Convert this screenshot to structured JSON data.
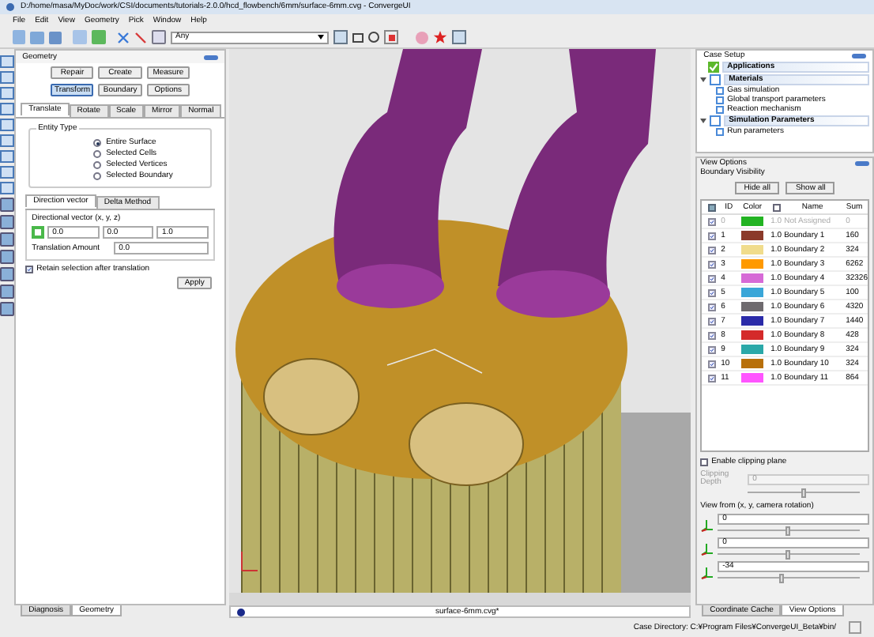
{
  "window": {
    "title": "D:/home/masa/MyDoc/work/CSI/documents/tutorials-2.0.0/hcd_flowbench/6mm/surface-6mm.cvg - ConvergeUI"
  },
  "menu": [
    "File",
    "Edit",
    "View",
    "Geometry",
    "Pick",
    "Window",
    "Help"
  ],
  "toolbar": {
    "filter_dropdown": "Any"
  },
  "geometry_panel": {
    "title": "Geometry",
    "buttons": [
      {
        "label": "Repair",
        "selected": false
      },
      {
        "label": "Create",
        "selected": false
      },
      {
        "label": "Measure",
        "selected": false
      },
      {
        "label": "Transform",
        "selected": true
      },
      {
        "label": "Boundary",
        "selected": false
      },
      {
        "label": "Options",
        "selected": false
      }
    ],
    "tabs": [
      {
        "label": "Translate",
        "selected": true
      },
      {
        "label": "Rotate",
        "selected": false
      },
      {
        "label": "Scale",
        "selected": false
      },
      {
        "label": "Mirror",
        "selected": false
      },
      {
        "label": "Normal",
        "selected": false
      }
    ],
    "entity_type": {
      "title": "Entity Type",
      "options": [
        {
          "label": "Entire Surface",
          "selected": true
        },
        {
          "label": "Selected Cells",
          "selected": false
        },
        {
          "label": "Selected Vertices",
          "selected": false
        },
        {
          "label": "Selected Boundary",
          "selected": false
        }
      ]
    },
    "method_tabs": [
      {
        "label": "Direction vector",
        "selected": true
      },
      {
        "label": "Delta Method",
        "selected": false
      }
    ],
    "vector_label": "Directional vector (x, y, z)",
    "vector": [
      "0.0",
      "0.0",
      "1.0"
    ],
    "amount_label": "Translation Amount",
    "amount": "0.0",
    "retain": {
      "label": "Retain selection after translation",
      "checked": true
    },
    "apply": "Apply"
  },
  "left_bottom_tabs": [
    {
      "label": "Diagnosis",
      "selected": false
    },
    {
      "label": "Geometry",
      "selected": true
    }
  ],
  "viewport_tab": "surface-6mm.cvg*",
  "case_setup": {
    "title": "Case Setup",
    "items": [
      {
        "label": "Applications",
        "checked": true
      },
      {
        "label": "Materials",
        "checked": false,
        "children": [
          {
            "label": "Gas simulation"
          },
          {
            "label": "Global transport parameters"
          },
          {
            "label": "Reaction mechanism"
          }
        ]
      },
      {
        "label": "Simulation Parameters",
        "checked": false,
        "children": [
          {
            "label": "Run parameters"
          }
        ]
      }
    ]
  },
  "view_options": {
    "title": "View Options",
    "subtitle": "Boundary Visibility",
    "buttons": [
      "Hide all",
      "Show all"
    ],
    "columns": [
      "ID",
      "Color",
      "Name",
      "Sum"
    ],
    "rows": [
      {
        "id": "0",
        "color": "#22b322",
        "opacity": "1.0",
        "name": "Not Assigned",
        "sum": "0",
        "checked": true,
        "disabled": true
      },
      {
        "id": "1",
        "color": "#8b3a2a",
        "opacity": "1.0",
        "name": "Boundary 1",
        "sum": "160",
        "checked": true,
        "disabled": false
      },
      {
        "id": "2",
        "color": "#f0dc8c",
        "opacity": "1.0",
        "name": "Boundary 2",
        "sum": "324",
        "checked": true,
        "disabled": false
      },
      {
        "id": "3",
        "color": "#ff9900",
        "opacity": "1.0",
        "name": "Boundary 3",
        "sum": "6262",
        "checked": true,
        "disabled": false
      },
      {
        "id": "4",
        "color": "#d66ad6",
        "opacity": "1.0",
        "name": "Boundary 4",
        "sum": "32326",
        "checked": true,
        "disabled": false
      },
      {
        "id": "5",
        "color": "#3aa6d8",
        "opacity": "1.0",
        "name": "Boundary 5",
        "sum": "100",
        "checked": true,
        "disabled": false
      },
      {
        "id": "6",
        "color": "#6e6a6e",
        "opacity": "1.0",
        "name": "Boundary 6",
        "sum": "4320",
        "checked": true,
        "disabled": false
      },
      {
        "id": "7",
        "color": "#2a2aa8",
        "opacity": "1.0",
        "name": "Boundary 7",
        "sum": "1440",
        "checked": true,
        "disabled": false
      },
      {
        "id": "8",
        "color": "#d42a2a",
        "opacity": "1.0",
        "name": "Boundary 8",
        "sum": "428",
        "checked": true,
        "disabled": false
      },
      {
        "id": "9",
        "color": "#2aa8a8",
        "opacity": "1.0",
        "name": "Boundary 9",
        "sum": "324",
        "checked": true,
        "disabled": false
      },
      {
        "id": "10",
        "color": "#b8700a",
        "opacity": "1.0",
        "name": "Boundary 10",
        "sum": "324",
        "checked": true,
        "disabled": false
      },
      {
        "id": "11",
        "color": "#ff55ff",
        "opacity": "1.0",
        "name": "Boundary 11",
        "sum": "864",
        "checked": true,
        "disabled": false
      }
    ],
    "clipping": {
      "label": "Enable clipping plane",
      "checked": false,
      "depth_label": "Clipping Depth",
      "depth": "0",
      "level": 0.5
    },
    "view_from_label": "View from (x, y, camera rotation)",
    "view_from": [
      {
        "value": "0",
        "level": 0.5
      },
      {
        "value": "0",
        "level": 0.5
      },
      {
        "value": "-34",
        "level": 0.45
      }
    ]
  },
  "right_bottom_tabs": [
    {
      "label": "Coordinate Cache",
      "selected": false
    },
    {
      "label": "View Options",
      "selected": true
    }
  ],
  "status_bar": "Case Directory: C:¥Program Files¥ConvergeUI_Beta¥bin/"
}
